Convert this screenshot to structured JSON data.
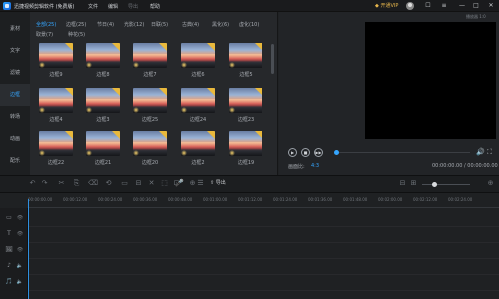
{
  "window": {
    "title": "迅捷视频剪辑软件 (免费版)",
    "menu": [
      "文件",
      "编辑",
      "导出",
      "帮助"
    ],
    "vip": "开通VIP",
    "controls": [
      "☐",
      "≡",
      "—",
      "□",
      "✕"
    ]
  },
  "sidebar": {
    "items": [
      {
        "label": "素材",
        "active": false
      },
      {
        "label": "文字",
        "active": false
      },
      {
        "label": "滤镜",
        "active": false
      },
      {
        "label": "边框",
        "active": true
      },
      {
        "label": "转场",
        "active": false
      },
      {
        "label": "动画",
        "active": false
      },
      {
        "label": "配乐",
        "active": false
      }
    ]
  },
  "filters": [
    {
      "label": "全部(25)",
      "active": true
    },
    {
      "label": "边框(25)",
      "active": false
    },
    {
      "label": "节日(4)",
      "active": false
    },
    {
      "label": "光影(12)",
      "active": false
    },
    {
      "label": "日联(5)",
      "active": false
    },
    {
      "label": "古典(4)",
      "active": false
    },
    {
      "label": "黑化(6)",
      "active": false
    },
    {
      "label": "虚化(10)",
      "active": false
    },
    {
      "label": "取景(7)",
      "active": false
    },
    {
      "label": "种花(5)",
      "active": false
    }
  ],
  "grid": {
    "rows": [
      [
        "边框9",
        "边框8",
        "边框7",
        "边框6",
        "边框5"
      ],
      [
        "边框4",
        "边框3",
        "边框25",
        "边框24",
        "边框23"
      ],
      [
        "边框22",
        "边框21",
        "边框20",
        "边框2",
        "边框19"
      ]
    ]
  },
  "preview": {
    "corner_label": "播放器 1:0",
    "ratio_label": "画面比:",
    "ratio_value": "4:3",
    "time": "00:00:00.00 / 00:00:00.00",
    "play_icon": "▶",
    "stop_icon": "■",
    "next_icon": "▶▶",
    "volume_icon": "🔊",
    "fullscreen_icon": "⛶"
  },
  "toolbar": {
    "export_label": "导出",
    "tools": [
      "↶",
      "↷",
      "✂",
      "⎘",
      "⌫",
      "⟲",
      "▭",
      "⊟",
      "✕",
      "⬚",
      "⊡",
      "🎤",
      "⊕",
      "☰"
    ],
    "zoom_out": "⊟",
    "zoom_box": "⊞",
    "zoom_plus": "⊕",
    "zoom_level": 0.25
  },
  "timeline": {
    "ticks": [
      "00:00:00.00",
      "00:00:12.00",
      "00:00:24.00",
      "00:00:36.00",
      "00:00:48.00",
      "00:01:00.00",
      "00:01:12.00",
      "00:01:24.00",
      "00:01:36.00",
      "00:01:48.00",
      "00:02:00.00",
      "00:02:12.00",
      "00:02:24.00"
    ],
    "track_icons": [
      "▭",
      "T",
      "🖼",
      "♪",
      "🎵"
    ],
    "track_icons_secondary": [
      "👁",
      "👁",
      "👁",
      "🔈",
      "🔈"
    ]
  }
}
